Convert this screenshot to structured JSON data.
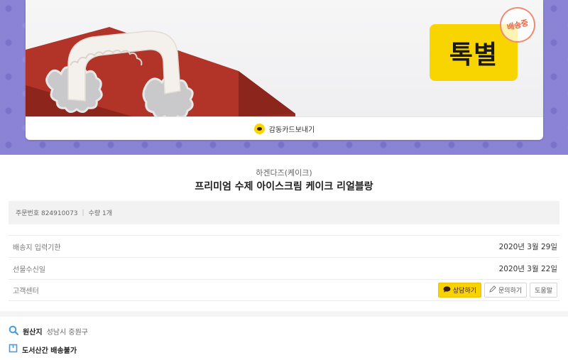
{
  "hero": {
    "sign_text": "톡별",
    "stamp_text": "배송중",
    "send_card_label": "감동카드보내기"
  },
  "product": {
    "brand": "하겐다즈(케이크)",
    "title": "프리미엄 수제 아이스크림 케이크 리얼블랑"
  },
  "order": {
    "number_label": "주문번호 824910073",
    "quantity_label": "수량 1개"
  },
  "rows": {
    "deadline": {
      "label": "배송지 입력기한",
      "value": "2020년 3월 29일"
    },
    "received": {
      "label": "선물수신일",
      "value": "2020년 3월 22일"
    },
    "support": {
      "label": "고객센터"
    }
  },
  "support_buttons": {
    "chat": "상담하기",
    "inquiry": "문의하기",
    "help": "도움말"
  },
  "origin": {
    "label": "원산지",
    "value": "성남시 중원구"
  },
  "shipping_note": {
    "label": "도서산간 배송불가"
  },
  "colors": {
    "kakao_yellow": "#f8d300",
    "hero_purple": "#8b84d6",
    "box_red": "#b23428"
  }
}
